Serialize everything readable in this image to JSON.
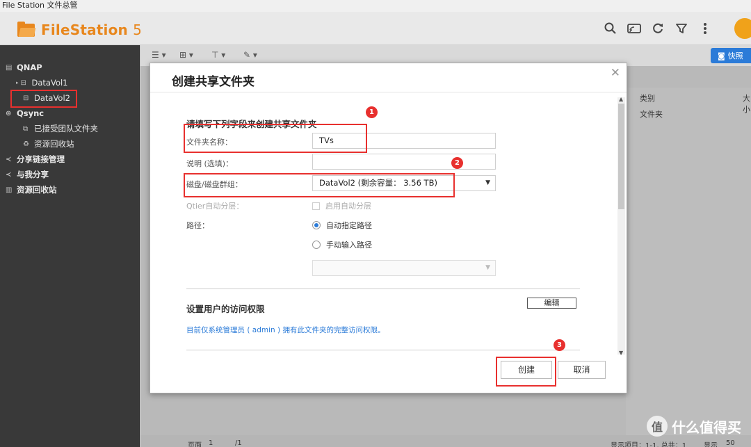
{
  "window": {
    "title": "File Station 文件总管"
  },
  "app": {
    "name": "FileStation",
    "version": "5",
    "avatar_letter": ""
  },
  "header": {
    "icons": [
      "search-icon",
      "cast-icon",
      "refresh-icon",
      "filter-icon",
      "more-icon"
    ]
  },
  "sidebar": {
    "root": "QNAP",
    "volumes": [
      "DataVol1",
      "DataVol2"
    ],
    "qsync": "Qsync",
    "qsync_items": [
      "已接受团队文件夹",
      "资源回收站"
    ],
    "items": [
      "分享链接管理",
      "与我分享",
      "资源回收站"
    ]
  },
  "toolbar": {
    "snapshot_label": "快照"
  },
  "list": {
    "columns": [
      "类别",
      "大小"
    ],
    "rows": [
      [
        "文件夹"
      ]
    ]
  },
  "footer": {
    "page_label": "页面",
    "page_value": "1",
    "page_total": "/1",
    "display_items": "显示项目：1-1, 总共：1",
    "display_label": "显示",
    "per_page": "50"
  },
  "watermark": {
    "logo_text": "值",
    "text": "什么值得买"
  },
  "dialog": {
    "title": "创建共享文件夹",
    "section_fields": "请填写下列字段来创建共享文件夹",
    "folder_name_label": "文件夹名称：",
    "folder_name_value": "TVs",
    "description_label": "说明 (选填)：",
    "description_value": "",
    "volume_label": "磁盘/磁盘群组：",
    "volume_value": "DataVol2 (剩余容量： 3.56 TB)",
    "qtier_label": "Qtier自动分层：",
    "qtier_option": "启用自动分层",
    "path_label": "路径：",
    "path_auto": "自动指定路径",
    "path_manual": "手动输入路径",
    "path_select_value": "",
    "section_permissions": "设置用户的访问权限",
    "edit_button": "编辑",
    "permission_info": "目前仅系统管理员 ( admin ) 拥有此文件夹的完整访问权限。",
    "create_button": "创建",
    "cancel_button": "取消"
  },
  "annotations": [
    "1",
    "2",
    "3"
  ],
  "colors": {
    "accent": "#e8871d",
    "annotation": "#e8302e",
    "link": "#2b7bd8"
  }
}
